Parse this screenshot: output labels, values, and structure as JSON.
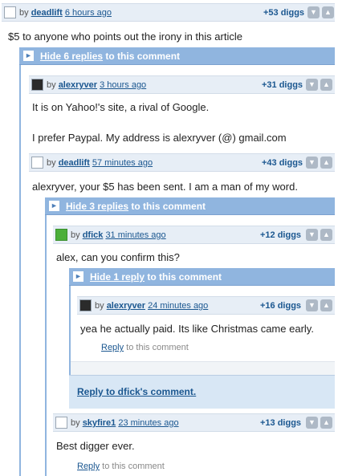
{
  "comments": [
    {
      "user": "deadlift",
      "time": "6 hours ago",
      "diggs": "+53 diggs",
      "by": "by",
      "text": "$5 to anyone who points out the irony in this article"
    },
    {
      "user": "alexryver",
      "time": "3 hours ago",
      "diggs": "+31 diggs",
      "by": "by",
      "text": "It is on Yahoo!'s site, a rival of Google.",
      "text2": "I prefer Paypal. My address is alexryver (@) gmail.com"
    },
    {
      "user": "deadlift",
      "time": "57 minutes ago",
      "diggs": "+43 diggs",
      "by": "by",
      "text": "alexryver, your $5 has been sent. I am a man of my word."
    },
    {
      "user": "dfick",
      "time": "31 minutes ago",
      "diggs": "+12 diggs",
      "by": "by",
      "text": "alex, can you confirm this?"
    },
    {
      "user": "alexryver",
      "time": "24 minutes ago",
      "diggs": "+16 diggs",
      "by": "by",
      "text": "yea he actually paid. Its like Christmas came early."
    },
    {
      "user": "skyfire1",
      "time": "23 minutes ago",
      "diggs": "+13 diggs",
      "by": "by",
      "text": "Best digger ever."
    }
  ],
  "toggles": [
    {
      "link": "Hide 6 replies",
      "rest": " to this comment"
    },
    {
      "link": "Hide 3 replies",
      "rest": " to this comment"
    },
    {
      "link": "Hide 1 reply",
      "rest": " to this comment"
    }
  ],
  "reply": {
    "link": "Reply",
    "rest": " to this comment"
  },
  "reply_to_dfick": "Reply to dfick's comment.",
  "colors": {
    "header_bg": "#e7eef6",
    "toggle_bg": "#90b5df",
    "link": "#1b5790"
  }
}
